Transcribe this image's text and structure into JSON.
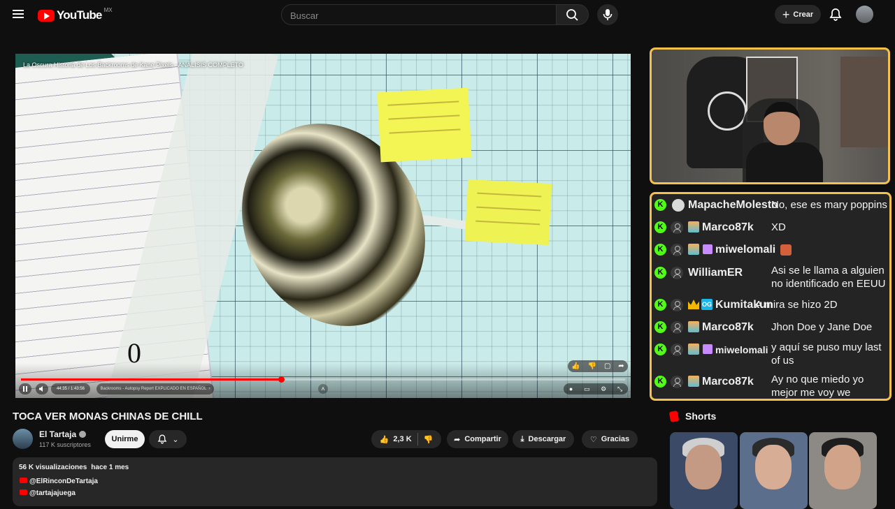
{
  "header": {
    "logo_text": "YouTube",
    "country_code": "MX",
    "search_placeholder": "Buscar",
    "create_label": "Crear"
  },
  "player": {
    "overlay_title": "La Oscura Historia de Los Backrooms de Kane Pixels - ANÁLISIS COMPLETO",
    "time": "44:35 / 1:43:56",
    "chapter": "Backrooms - Autopsy Report EXPLICADO EN ESPAÑOL",
    "progress_fraction": 0.43,
    "zero_label": "0"
  },
  "chat": {
    "messages": [
      {
        "user": "MapacheMolesto",
        "text": "No, ese es mary poppins"
      },
      {
        "user": "Marco87k",
        "text": "XD"
      },
      {
        "user": "miwelomali",
        "text": ""
      },
      {
        "user": "WilliamER",
        "text": "Asi se le llama a alguien no identificado en EEUU"
      },
      {
        "user": "Kumitakun",
        "text": "A mira se hizo 2D"
      },
      {
        "user": "Marco87k",
        "text": "Jhon Doe y Jane Doe"
      },
      {
        "user": "miwelomali",
        "text": "y aquí se puso muy last of us"
      },
      {
        "user": "Marco87k",
        "text": "Ay no que miedo yo mejor me voy we"
      }
    ],
    "kick_badge": "K",
    "og_badge": "OG"
  },
  "video": {
    "title": "TOCA VER MONAS CHINAS DE CHILL",
    "channel": "El Tartaja",
    "subscribers": "117 K suscriptores",
    "join_label": "Unirme",
    "likes": "2,3 K",
    "share_label": "Compartir",
    "download_label": "Descargar",
    "thanks_label": "Gracias",
    "views": "56 K visualizaciones",
    "age": "hace 1 mes",
    "links": [
      "@ElRinconDeTartaja",
      "@tartajajuega"
    ]
  },
  "shorts": {
    "heading": "Shorts"
  },
  "colors": {
    "accent": "#ff0000",
    "overlay_border": "#f4c14c",
    "kick_green": "#53fc18"
  }
}
